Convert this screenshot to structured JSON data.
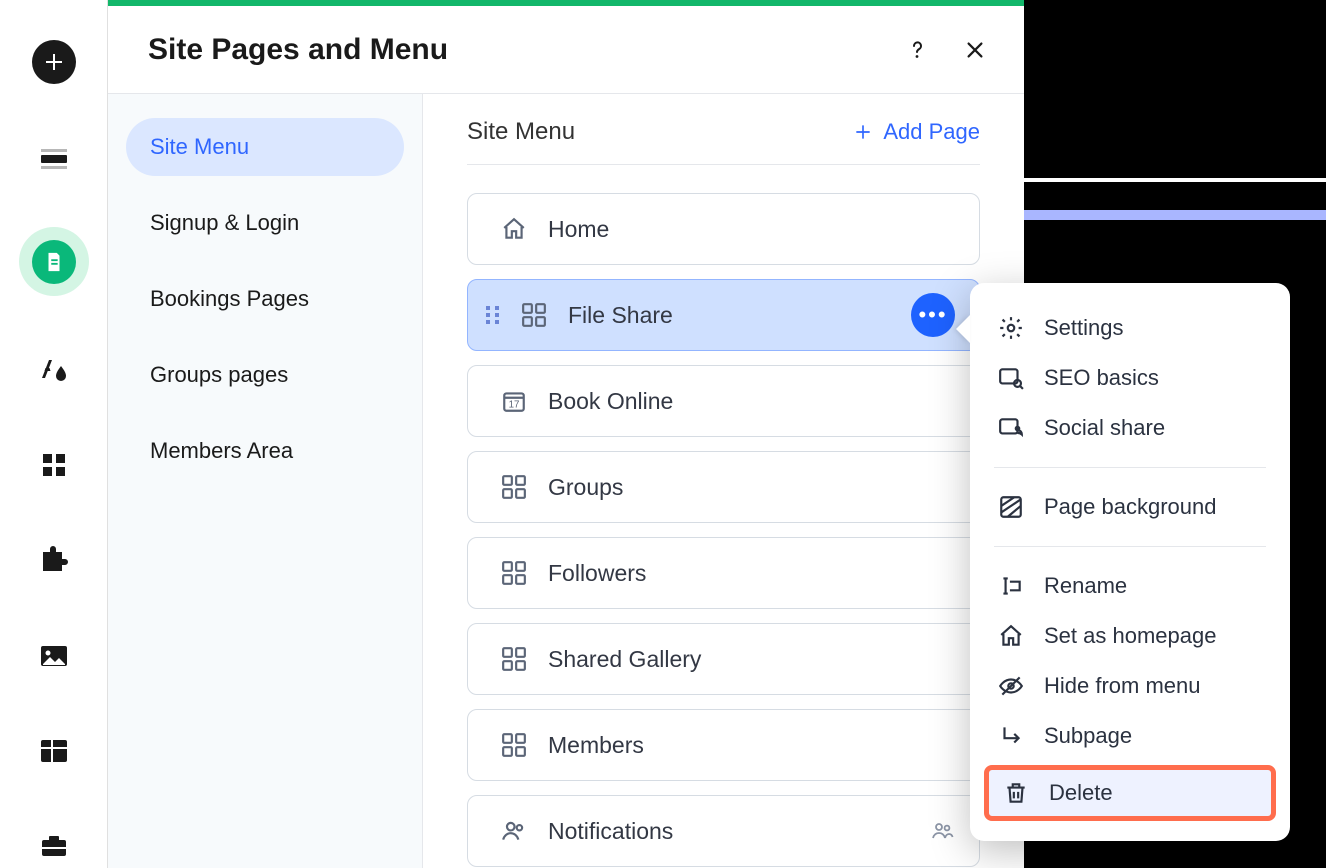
{
  "header": {
    "title": "Site Pages and Menu"
  },
  "sidebar": {
    "items": [
      {
        "label": "Site Menu"
      },
      {
        "label": "Signup & Login"
      },
      {
        "label": "Bookings Pages"
      },
      {
        "label": "Groups pages"
      },
      {
        "label": "Members Area"
      }
    ]
  },
  "pages": {
    "heading": "Site Menu",
    "add_label": "Add Page",
    "items": [
      {
        "label": "Home"
      },
      {
        "label": "File Share"
      },
      {
        "label": "Book Online"
      },
      {
        "label": "Groups"
      },
      {
        "label": "Followers"
      },
      {
        "label": "Shared Gallery"
      },
      {
        "label": "Members"
      },
      {
        "label": "Notifications"
      }
    ]
  },
  "context_menu": {
    "items": [
      {
        "label": "Settings"
      },
      {
        "label": "SEO basics"
      },
      {
        "label": "Social share"
      },
      {
        "label": "Page background"
      },
      {
        "label": "Rename"
      },
      {
        "label": "Set as homepage"
      },
      {
        "label": "Hide from menu"
      },
      {
        "label": "Subpage"
      },
      {
        "label": "Delete"
      }
    ]
  }
}
